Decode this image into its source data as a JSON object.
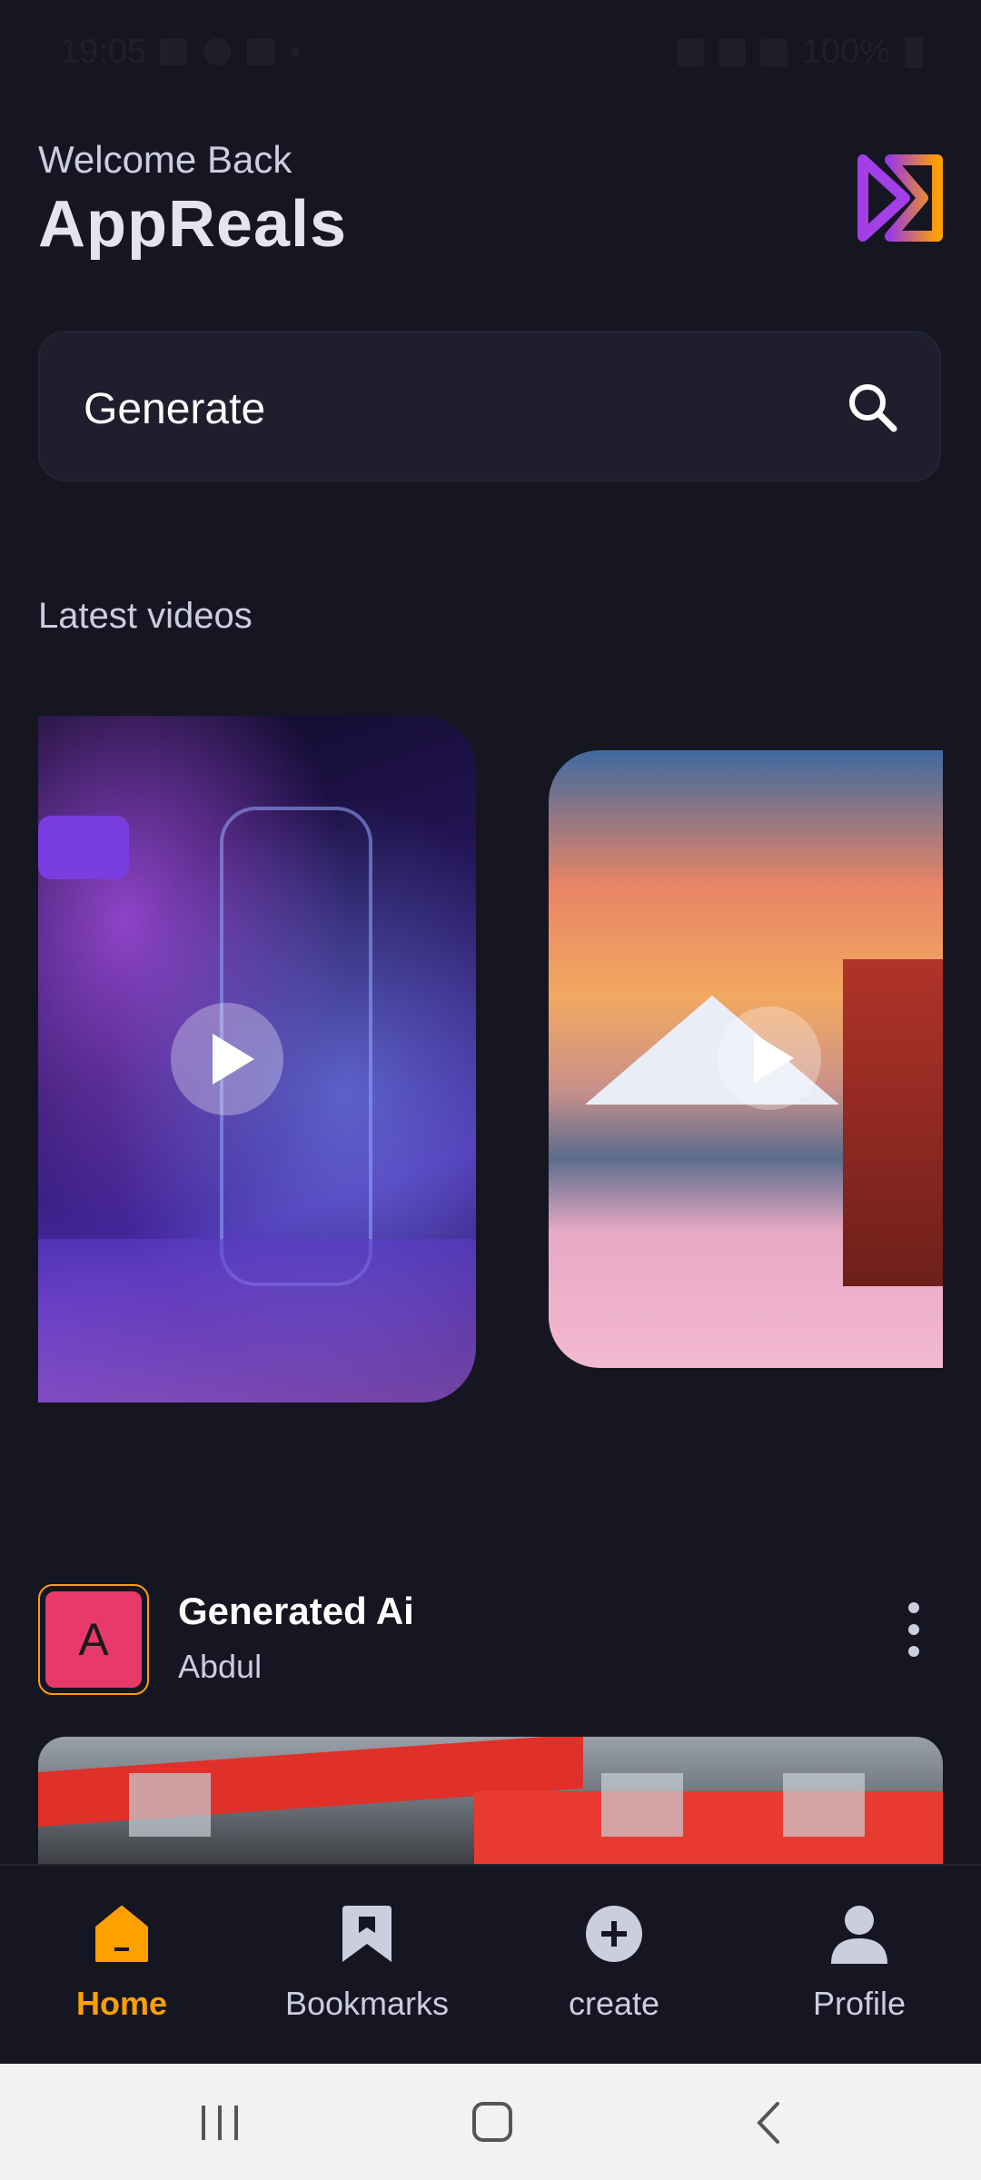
{
  "status_bar": {
    "time": "19:05",
    "battery": "100%"
  },
  "header": {
    "welcome": "Welcome Back",
    "title": "AppReals"
  },
  "search": {
    "value": "Generate",
    "placeholder": "Generate"
  },
  "latest": {
    "title": "Latest  videos"
  },
  "post": {
    "avatar_letter": "A",
    "title": "Generated Ai",
    "author": "Abdul"
  },
  "tabs": [
    {
      "label": "Home",
      "icon": "home-icon",
      "active": true
    },
    {
      "label": "Bookmarks",
      "icon": "bookmark-icon",
      "active": false
    },
    {
      "label": "create",
      "icon": "plus-circle-icon",
      "active": false
    },
    {
      "label": "Profile",
      "icon": "profile-icon",
      "active": false
    }
  ],
  "colors": {
    "background": "#161622",
    "accent": "#FFA001",
    "search_bg": "#1E1E2D",
    "avatar_bg": "#E83A6A"
  }
}
